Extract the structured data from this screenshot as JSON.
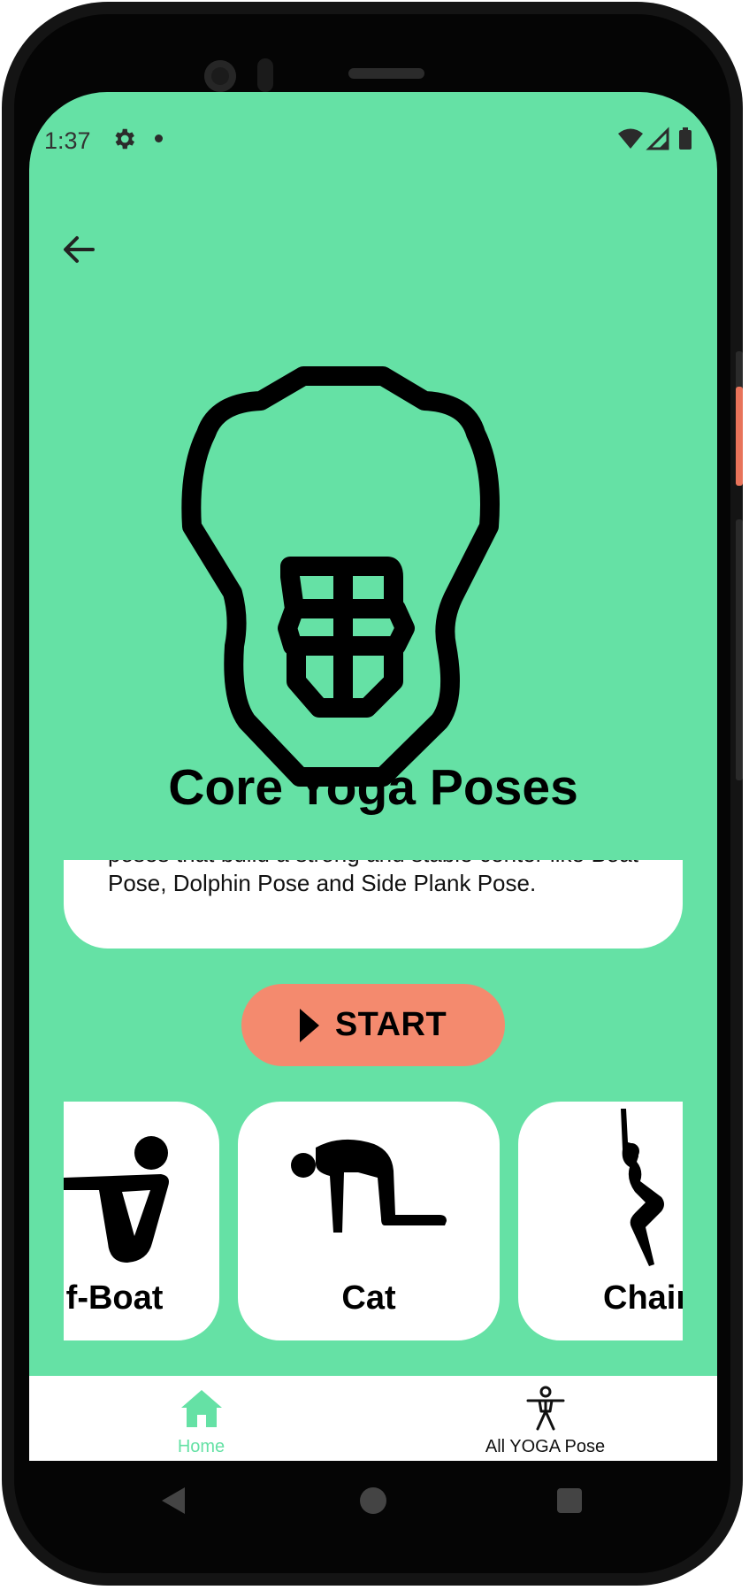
{
  "status_bar": {
    "time": "1:37",
    "icons": [
      "gear-icon",
      "notification-dot-icon",
      "wifi-icon",
      "cell-signal-icon",
      "battery-icon"
    ]
  },
  "header": {
    "back_icon": "arrow-left-icon"
  },
  "hero": {
    "icon": "core-abs-icon",
    "title": "Core Yoga Poses"
  },
  "description": {
    "text": "poses that build a strong and stable center like Boat Pose, Dolphin Pose and Side Plank Pose."
  },
  "start_button": {
    "icon": "play-icon",
    "label": "START"
  },
  "poses": [
    {
      "label": "Half-Boat",
      "visible_label": "lf-Boat",
      "icon": "half-boat-pose-icon"
    },
    {
      "label": "Cat",
      "visible_label": "Cat",
      "icon": "cat-pose-icon"
    },
    {
      "label": "Chair",
      "visible_label": "Chai",
      "icon": "chair-pose-icon"
    }
  ],
  "bottom_nav": {
    "items": [
      {
        "label": "Home",
        "icon": "home-icon",
        "active": true
      },
      {
        "label": "All YOGA Pose",
        "icon": "person-icon",
        "active": false
      }
    ]
  },
  "colors": {
    "background": "#65e1a5",
    "accent_button": "#f48a6e",
    "card": "#ffffff",
    "nav_active": "#65e1a5"
  }
}
